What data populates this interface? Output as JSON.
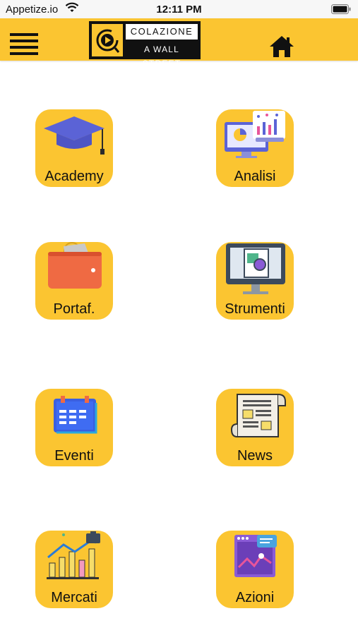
{
  "status_bar": {
    "carrier": "Appetize.io",
    "time": "12:11 PM"
  },
  "header": {
    "logo_top": "COLAZIONE",
    "logo_bottom": "A WALL STREET"
  },
  "tiles": [
    {
      "label": "Academy",
      "icon": "graduation-cap-icon"
    },
    {
      "label": "Analisi",
      "icon": "analytics-monitor-icon"
    },
    {
      "label": "Portaf.",
      "icon": "wallet-icon"
    },
    {
      "label": "Strumenti",
      "icon": "monitor-tools-icon"
    },
    {
      "label": "Eventi",
      "icon": "calendar-icon"
    },
    {
      "label": "News",
      "icon": "newspaper-icon"
    },
    {
      "label": "Mercati",
      "icon": "market-chart-icon"
    },
    {
      "label": "Azioni",
      "icon": "stock-window-icon"
    }
  ],
  "colors": {
    "accent": "#fbc531",
    "text": "#111111"
  }
}
